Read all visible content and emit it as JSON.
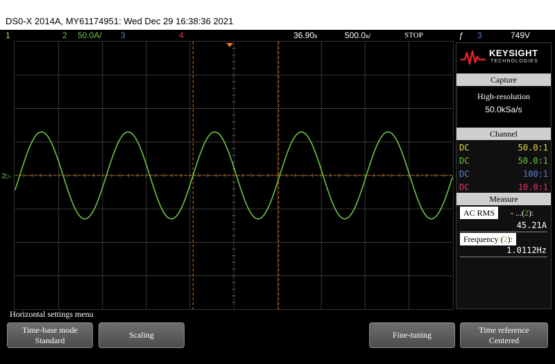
{
  "window_title": "DS0-X 2014A, MY61174951: Wed Dec 29 16:38:36 2021",
  "status_bar": {
    "ch1": "1",
    "ch2_num": "2",
    "ch2_scale": "50.0A/",
    "ch3": "3",
    "ch4": "4",
    "time_delay": "36.90",
    "time_delay_unit": "s",
    "timebase": "500.0",
    "timebase_unit": "s/",
    "run_state": "STOP",
    "trigger_symbol": "ƒ",
    "trigger_source": "3",
    "trigger_level": "749V"
  },
  "colors": {
    "ch1": "#e6d84a",
    "ch2": "#6cc644",
    "ch3": "#5c7fd6",
    "ch4": "#e0356a",
    "cursor": "#e07a1a",
    "grid": "#3b3b3b"
  },
  "waveform": {
    "channel": 2,
    "periods_on_screen": 5.05,
    "amplitude_divs": 1.3,
    "zero_level_div": 4.0
  },
  "panel": {
    "brand": "KEYSIGHT",
    "brand_sub": "TECHNOLOGIES",
    "capture": {
      "header": "Capture",
      "mode": "High-resolution",
      "rate": "50.0kSa/s"
    },
    "channel": {
      "header": "Channel",
      "rows": [
        {
          "coupling": "DC",
          "probe": "50.0:1",
          "color": "#e6d84a"
        },
        {
          "coupling": "DC",
          "probe": "50.0:1",
          "color": "#6cc644"
        },
        {
          "coupling": "DC",
          "probe": "100:1",
          "color": "#5c7fd6"
        },
        {
          "coupling": "DC",
          "probe": "10.0:1",
          "color": "#e0356a"
        }
      ]
    },
    "measure": {
      "header": "Measure",
      "items": [
        {
          "label": "AC RMS",
          "source_prefix": "- ...(",
          "source_ch": "2",
          "source_suffix": "):",
          "value": "45.21A"
        },
        {
          "label": "Frequency (",
          "source_ch": "2",
          "label_suffix": "):",
          "value": "1.0112Hz"
        }
      ]
    }
  },
  "menu": {
    "title": "Horizontal settings menu",
    "softkeys": [
      {
        "line1": "Time-base mode",
        "line2": "Standard"
      },
      {
        "line1": "Scaling",
        "line2": ""
      },
      {
        "line1": "Fine-tuning",
        "line2": ""
      },
      {
        "line1": "Time reference",
        "line2": "Centered"
      }
    ]
  }
}
